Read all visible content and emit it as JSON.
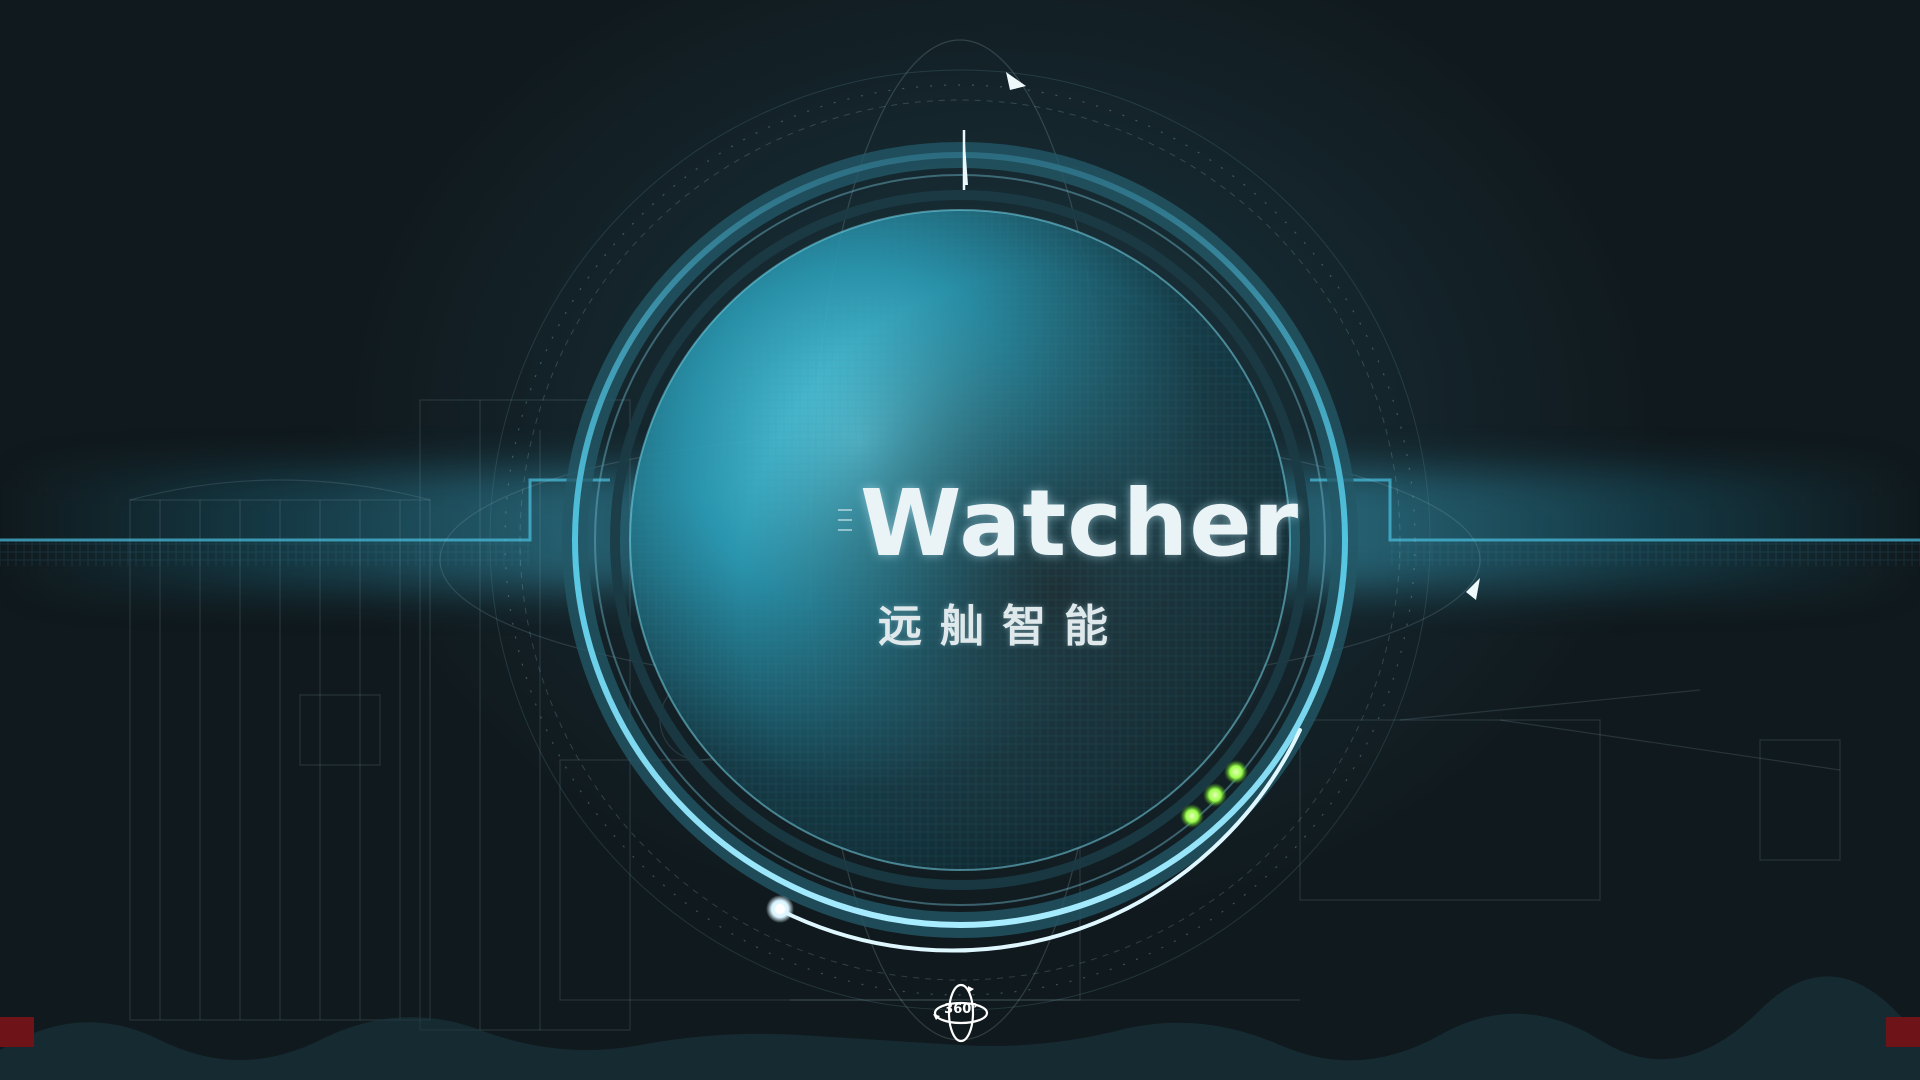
{
  "brand": {
    "title": "Watcher",
    "subtitle": "远舢智能"
  },
  "controls": {
    "view_360_label": "360°"
  },
  "indicators": {
    "status_dots_count": 3
  },
  "colors": {
    "background": "#10191d",
    "accent_cyan": "#3cc8e6",
    "status_green": "#9cff4a",
    "edge_red": "#6e1418",
    "title_white": "#eaf3f6"
  },
  "icons": {
    "view_360": "rotate-360-icon"
  }
}
